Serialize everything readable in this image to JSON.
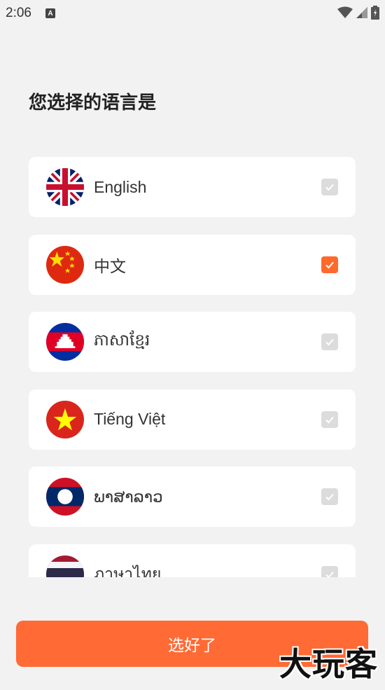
{
  "status_bar": {
    "time": "2:06",
    "notification_icon": "A"
  },
  "page": {
    "title": "您选择的语言是"
  },
  "languages": [
    {
      "label": "English",
      "flag": "uk-flag-icon",
      "checked": false
    },
    {
      "label": "中文",
      "flag": "china-flag-icon",
      "checked": true
    },
    {
      "label": "ភាសាខ្មែរ",
      "flag": "cambodia-flag-icon",
      "checked": false
    },
    {
      "label": "Tiếng Việt",
      "flag": "vietnam-flag-icon",
      "checked": false
    },
    {
      "label": "ພາສາລາວ",
      "flag": "laos-flag-icon",
      "checked": false
    },
    {
      "label": "ภาษาไทย",
      "flag": "thailand-flag-icon",
      "checked": false
    }
  ],
  "confirm_button": {
    "label": "选好了"
  },
  "watermark": {
    "text": "大玩客"
  },
  "colors": {
    "accent": "#ff6a35",
    "checked": "#ff6a2c",
    "unchecked": "#dcdcdc",
    "background": "#f2f2f2",
    "card": "#ffffff"
  }
}
